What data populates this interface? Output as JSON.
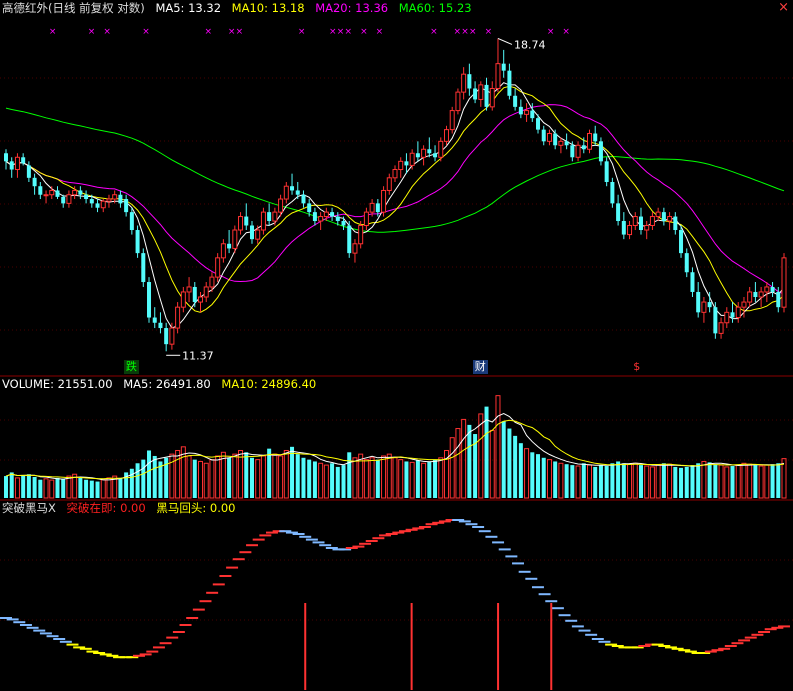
{
  "title": "高德红外(日线 前复权 对数)",
  "ma_labels": [
    {
      "text": "MA5: 13.32",
      "color": "#ffffff"
    },
    {
      "text": "MA10: 13.18",
      "color": "#ffff00"
    },
    {
      "text": "MA20: 13.36",
      "color": "#ff00ff"
    },
    {
      "text": "MA60: 15.23",
      "color": "#00ff00"
    }
  ],
  "volume_labels": [
    {
      "text": "VOLUME: 21551.00",
      "color": "#ffffff"
    },
    {
      "text": "MA5: 26491.80",
      "color": "#ffffff"
    },
    {
      "text": "MA10: 24896.40",
      "color": "#ffff00"
    }
  ],
  "indicator_labels": [
    {
      "text": "突破黑马X",
      "color": "#dddddd"
    },
    {
      "text": "突破在即: 0.00",
      "color": "#ff2020"
    },
    {
      "text": "黑马回头: 0.00",
      "color": "#ffff00"
    }
  ],
  "markers": {
    "fall": "跌",
    "finance": "财",
    "dollar": "$"
  },
  "close_icon": "×",
  "colors": {
    "up": "#ff3232",
    "down": "#54fcfc",
    "ma5": "#ffffff",
    "ma10": "#ffff00",
    "ma20": "#ff00ff",
    "ma60": "#00ff00",
    "signal": "#ff00ff",
    "grid": "#8b0000"
  },
  "chart_data": [
    {
      "type": "candlestick",
      "scale": "log",
      "ylim": [
        11.0,
        19.3
      ],
      "high_annotation": "18.74",
      "low_annotation": "11.37",
      "ohlc": [
        [
          15.6,
          15.7,
          15.2,
          15.4
        ],
        [
          15.4,
          15.5,
          15.0,
          15.2
        ],
        [
          15.2,
          15.6,
          15.0,
          15.5
        ],
        [
          15.5,
          15.6,
          15.3,
          15.35
        ],
        [
          15.3,
          15.4,
          14.9,
          15.0
        ],
        [
          15.0,
          15.1,
          14.6,
          14.8
        ],
        [
          14.8,
          14.9,
          14.5,
          14.6
        ],
        [
          14.6,
          14.7,
          14.4,
          14.6
        ],
        [
          14.6,
          14.8,
          14.5,
          14.7
        ],
        [
          14.7,
          14.8,
          14.5,
          14.55
        ],
        [
          14.55,
          14.6,
          14.3,
          14.4
        ],
        [
          14.4,
          14.7,
          14.3,
          14.6
        ],
        [
          14.6,
          14.8,
          14.5,
          14.7
        ],
        [
          14.7,
          14.8,
          14.5,
          14.6
        ],
        [
          14.6,
          14.7,
          14.4,
          14.5
        ],
        [
          14.5,
          14.6,
          14.3,
          14.4
        ],
        [
          14.4,
          14.5,
          14.2,
          14.3
        ],
        [
          14.3,
          14.5,
          14.2,
          14.45
        ],
        [
          14.45,
          14.6,
          14.3,
          14.5
        ],
        [
          14.5,
          14.7,
          14.4,
          14.6
        ],
        [
          14.6,
          14.7,
          14.3,
          14.4
        ],
        [
          14.5,
          14.6,
          14.1,
          14.2
        ],
        [
          14.2,
          14.3,
          13.7,
          13.8
        ],
        [
          13.8,
          13.9,
          13.2,
          13.3
        ],
        [
          13.3,
          13.4,
          12.6,
          12.7
        ],
        [
          12.7,
          12.8,
          11.9,
          12.0
        ],
        [
          12.0,
          12.2,
          11.8,
          11.9
        ],
        [
          11.9,
          12.1,
          11.7,
          11.8
        ],
        [
          11.8,
          11.9,
          11.37,
          11.5
        ],
        [
          11.5,
          11.9,
          11.4,
          11.8
        ],
        [
          11.8,
          12.3,
          11.7,
          12.2
        ],
        [
          12.2,
          12.6,
          12.1,
          12.5
        ],
        [
          12.5,
          12.8,
          12.3,
          12.6
        ],
        [
          12.6,
          12.7,
          12.2,
          12.3
        ],
        [
          12.3,
          12.5,
          12.1,
          12.4
        ],
        [
          12.4,
          12.7,
          12.3,
          12.6
        ],
        [
          12.6,
          12.9,
          12.5,
          12.8
        ],
        [
          12.8,
          13.3,
          12.7,
          13.2
        ],
        [
          13.2,
          13.6,
          13.1,
          13.5
        ],
        [
          13.5,
          13.8,
          13.3,
          13.4
        ],
        [
          13.4,
          13.9,
          13.3,
          13.8
        ],
        [
          13.8,
          14.2,
          13.7,
          14.1
        ],
        [
          14.1,
          14.4,
          13.8,
          13.9
        ],
        [
          13.9,
          14.0,
          13.5,
          13.6
        ],
        [
          13.6,
          13.9,
          13.5,
          13.8
        ],
        [
          13.8,
          14.3,
          13.7,
          14.2
        ],
        [
          14.2,
          14.4,
          13.9,
          14.0
        ],
        [
          14.0,
          14.3,
          13.9,
          14.2
        ],
        [
          14.2,
          14.6,
          14.1,
          14.5
        ],
        [
          14.5,
          14.9,
          14.4,
          14.8
        ],
        [
          14.8,
          15.1,
          14.6,
          14.7
        ],
        [
          14.7,
          14.9,
          14.5,
          14.6
        ],
        [
          14.6,
          14.7,
          14.3,
          14.4
        ],
        [
          14.4,
          14.5,
          14.1,
          14.2
        ],
        [
          14.2,
          14.3,
          13.9,
          14.0
        ],
        [
          14.0,
          14.2,
          13.8,
          14.1
        ],
        [
          14.1,
          14.3,
          14.0,
          14.2
        ],
        [
          14.2,
          14.3,
          14.0,
          14.1
        ],
        [
          14.1,
          14.2,
          13.9,
          14.0
        ],
        [
          14.0,
          14.1,
          13.8,
          13.9
        ],
        [
          13.9,
          14.0,
          13.2,
          13.3
        ],
        [
          13.3,
          13.6,
          13.1,
          13.5
        ],
        [
          13.5,
          14.0,
          13.4,
          13.9
        ],
        [
          13.9,
          14.3,
          13.8,
          14.2
        ],
        [
          14.2,
          14.5,
          14.1,
          14.4
        ],
        [
          14.4,
          14.5,
          14.1,
          14.2
        ],
        [
          14.2,
          14.8,
          14.1,
          14.7
        ],
        [
          14.7,
          15.1,
          14.6,
          15.0
        ],
        [
          15.0,
          15.3,
          14.9,
          15.2
        ],
        [
          15.2,
          15.5,
          15.0,
          15.4
        ],
        [
          15.4,
          15.6,
          15.1,
          15.3
        ],
        [
          15.3,
          15.7,
          15.2,
          15.6
        ],
        [
          15.6,
          15.9,
          15.4,
          15.5
        ],
        [
          15.5,
          15.8,
          15.3,
          15.7
        ],
        [
          15.7,
          16.0,
          15.5,
          15.6
        ],
        [
          15.6,
          15.8,
          15.4,
          15.5
        ],
        [
          15.5,
          16.0,
          15.4,
          15.9
        ],
        [
          15.9,
          16.3,
          15.8,
          16.2
        ],
        [
          16.2,
          16.8,
          16.1,
          16.7
        ],
        [
          16.7,
          17.3,
          16.6,
          17.2
        ],
        [
          17.2,
          17.9,
          17.0,
          17.7
        ],
        [
          17.7,
          18.0,
          17.1,
          17.3
        ],
        [
          17.3,
          17.5,
          16.9,
          17.0
        ],
        [
          17.0,
          17.5,
          16.8,
          17.4
        ],
        [
          17.4,
          17.6,
          16.7,
          16.8
        ],
        [
          16.8,
          17.5,
          16.7,
          17.3
        ],
        [
          17.3,
          18.74,
          17.2,
          18.0
        ],
        [
          18.0,
          18.4,
          17.6,
          17.8
        ],
        [
          17.8,
          18.0,
          17.0,
          17.1
        ],
        [
          17.1,
          17.3,
          16.7,
          16.8
        ],
        [
          16.8,
          17.0,
          16.5,
          16.6
        ],
        [
          16.6,
          16.9,
          16.4,
          16.7
        ],
        [
          16.7,
          16.9,
          16.4,
          16.5
        ],
        [
          16.5,
          16.6,
          16.1,
          16.2
        ],
        [
          16.2,
          16.3,
          15.8,
          15.9
        ],
        [
          15.9,
          16.2,
          15.8,
          16.1
        ],
        [
          16.1,
          16.2,
          15.7,
          15.8
        ],
        [
          15.8,
          16.0,
          15.6,
          15.9
        ],
        [
          15.9,
          16.1,
          15.7,
          15.8
        ],
        [
          15.8,
          15.9,
          15.4,
          15.5
        ],
        [
          15.5,
          15.9,
          15.4,
          15.8
        ],
        [
          15.8,
          16.0,
          15.6,
          15.7
        ],
        [
          15.7,
          16.2,
          15.6,
          16.1
        ],
        [
          16.1,
          16.3,
          15.8,
          15.9
        ],
        [
          15.9,
          16.0,
          15.3,
          15.4
        ],
        [
          15.4,
          15.5,
          14.8,
          14.9
        ],
        [
          14.9,
          15.0,
          14.3,
          14.4
        ],
        [
          14.4,
          14.6,
          13.9,
          14.0
        ],
        [
          14.0,
          14.2,
          13.6,
          13.7
        ],
        [
          13.7,
          14.0,
          13.6,
          13.9
        ],
        [
          13.9,
          14.2,
          13.8,
          14.1
        ],
        [
          14.1,
          14.3,
          13.7,
          13.8
        ],
        [
          13.8,
          14.0,
          13.6,
          13.9
        ],
        [
          13.9,
          14.2,
          13.8,
          14.1
        ],
        [
          14.1,
          14.3,
          14.0,
          14.2
        ],
        [
          14.2,
          14.3,
          13.9,
          14.0
        ],
        [
          14.0,
          14.2,
          13.8,
          14.1
        ],
        [
          14.1,
          14.2,
          13.7,
          13.8
        ],
        [
          13.8,
          13.9,
          13.2,
          13.3
        ],
        [
          13.3,
          13.4,
          12.8,
          12.9
        ],
        [
          12.9,
          13.0,
          12.4,
          12.5
        ],
        [
          12.5,
          12.7,
          12.0,
          12.1
        ],
        [
          12.1,
          12.4,
          11.9,
          12.3
        ],
        [
          12.3,
          12.5,
          12.1,
          12.2
        ],
        [
          12.2,
          12.3,
          11.6,
          11.7
        ],
        [
          11.7,
          12.0,
          11.6,
          11.9
        ],
        [
          11.9,
          12.2,
          11.8,
          12.1
        ],
        [
          12.1,
          12.3,
          11.9,
          12.0
        ],
        [
          12.0,
          12.3,
          11.9,
          12.2
        ],
        [
          12.2,
          12.4,
          12.0,
          12.3
        ],
        [
          12.3,
          12.6,
          12.2,
          12.5
        ],
        [
          12.5,
          12.7,
          12.3,
          12.4
        ],
        [
          12.4,
          12.6,
          12.2,
          12.5
        ],
        [
          12.5,
          12.7,
          12.3,
          12.6
        ],
        [
          12.6,
          12.7,
          12.4,
          12.5
        ],
        [
          12.5,
          12.6,
          12.1,
          12.2
        ],
        [
          12.2,
          13.3,
          12.1,
          13.2
        ]
      ],
      "fall_marker_index": 22,
      "finance_marker_index": 83,
      "dollar_marker_index": 110
    },
    {
      "type": "bar",
      "name": "VOLUME",
      "values": [
        12000,
        14000,
        11000,
        12500,
        13000,
        11500,
        10000,
        10500,
        9800,
        11000,
        10500,
        12000,
        13000,
        11000,
        10000,
        9500,
        9000,
        10000,
        11000,
        12000,
        11000,
        14000,
        16000,
        19000,
        21000,
        26000,
        23000,
        20000,
        22000,
        24000,
        26000,
        28000,
        23000,
        21000,
        20000,
        19000,
        21000,
        23000,
        25000,
        22000,
        24000,
        26000,
        25000,
        22000,
        21000,
        23000,
        27000,
        24000,
        23000,
        26000,
        28000,
        24000,
        22000,
        21000,
        20000,
        19000,
        18000,
        19000,
        17000,
        18000,
        25000,
        22000,
        24000,
        21000,
        22000,
        21000,
        23000,
        24000,
        22000,
        21000,
        20000,
        19500,
        20500,
        19000,
        20000,
        21000,
        22000,
        26000,
        33000,
        38000,
        43000,
        40000,
        35000,
        46000,
        50000,
        37000,
        56000,
        42000,
        38000,
        34000,
        30000,
        27000,
        25000,
        24000,
        22000,
        21000,
        20000,
        19000,
        18500,
        18000,
        17500,
        19000,
        18000,
        17000,
        18000,
        17500,
        19000,
        20000,
        19000,
        18500,
        19000,
        18000,
        17500,
        17000,
        18000,
        19000,
        18500,
        17000,
        16500,
        17000,
        18000,
        19000,
        20000,
        19500,
        18500,
        18000,
        17000,
        17500,
        18000,
        19000,
        18500,
        18000,
        17500,
        18000,
        18500,
        19000,
        21551
      ],
      "ma5_label": "26491.80",
      "ma10_label": "24896.40"
    },
    {
      "type": "line",
      "name": "突破黑马X",
      "values": [
        0.3,
        0.29,
        0.27,
        0.25,
        0.23,
        0.21,
        0.19,
        0.17,
        0.15,
        0.13,
        0.11,
        0.09,
        0.08,
        0.06,
        0.05,
        0.04,
        0.03,
        0.02,
        0.02,
        0.02,
        0.03,
        0.04,
        0.06,
        0.09,
        0.12,
        0.16,
        0.2,
        0.25,
        0.3,
        0.36,
        0.42,
        0.48,
        0.54,
        0.6,
        0.66,
        0.72,
        0.77,
        0.82,
        0.86,
        0.89,
        0.91,
        0.92,
        0.92,
        0.91,
        0.9,
        0.88,
        0.86,
        0.84,
        0.82,
        0.8,
        0.79,
        0.79,
        0.8,
        0.81,
        0.83,
        0.85,
        0.87,
        0.89,
        0.9,
        0.91,
        0.92,
        0.93,
        0.94,
        0.95,
        0.97,
        0.98,
        0.99,
        1.0,
        1.0,
        0.99,
        0.97,
        0.95,
        0.92,
        0.88,
        0.84,
        0.79,
        0.74,
        0.69,
        0.63,
        0.58,
        0.52,
        0.47,
        0.42,
        0.37,
        0.32,
        0.28,
        0.24,
        0.21,
        0.18,
        0.15,
        0.13,
        0.11,
        0.1,
        0.09,
        0.09,
        0.09,
        0.1,
        0.11,
        0.11,
        0.1,
        0.09,
        0.08,
        0.07,
        0.06,
        0.05,
        0.05,
        0.06,
        0.07,
        0.08,
        0.1,
        0.12,
        0.14,
        0.16,
        0.18,
        0.2,
        0.22,
        0.23,
        0.24
      ],
      "signal_indices": [
        45,
        61,
        74,
        82
      ]
    }
  ]
}
